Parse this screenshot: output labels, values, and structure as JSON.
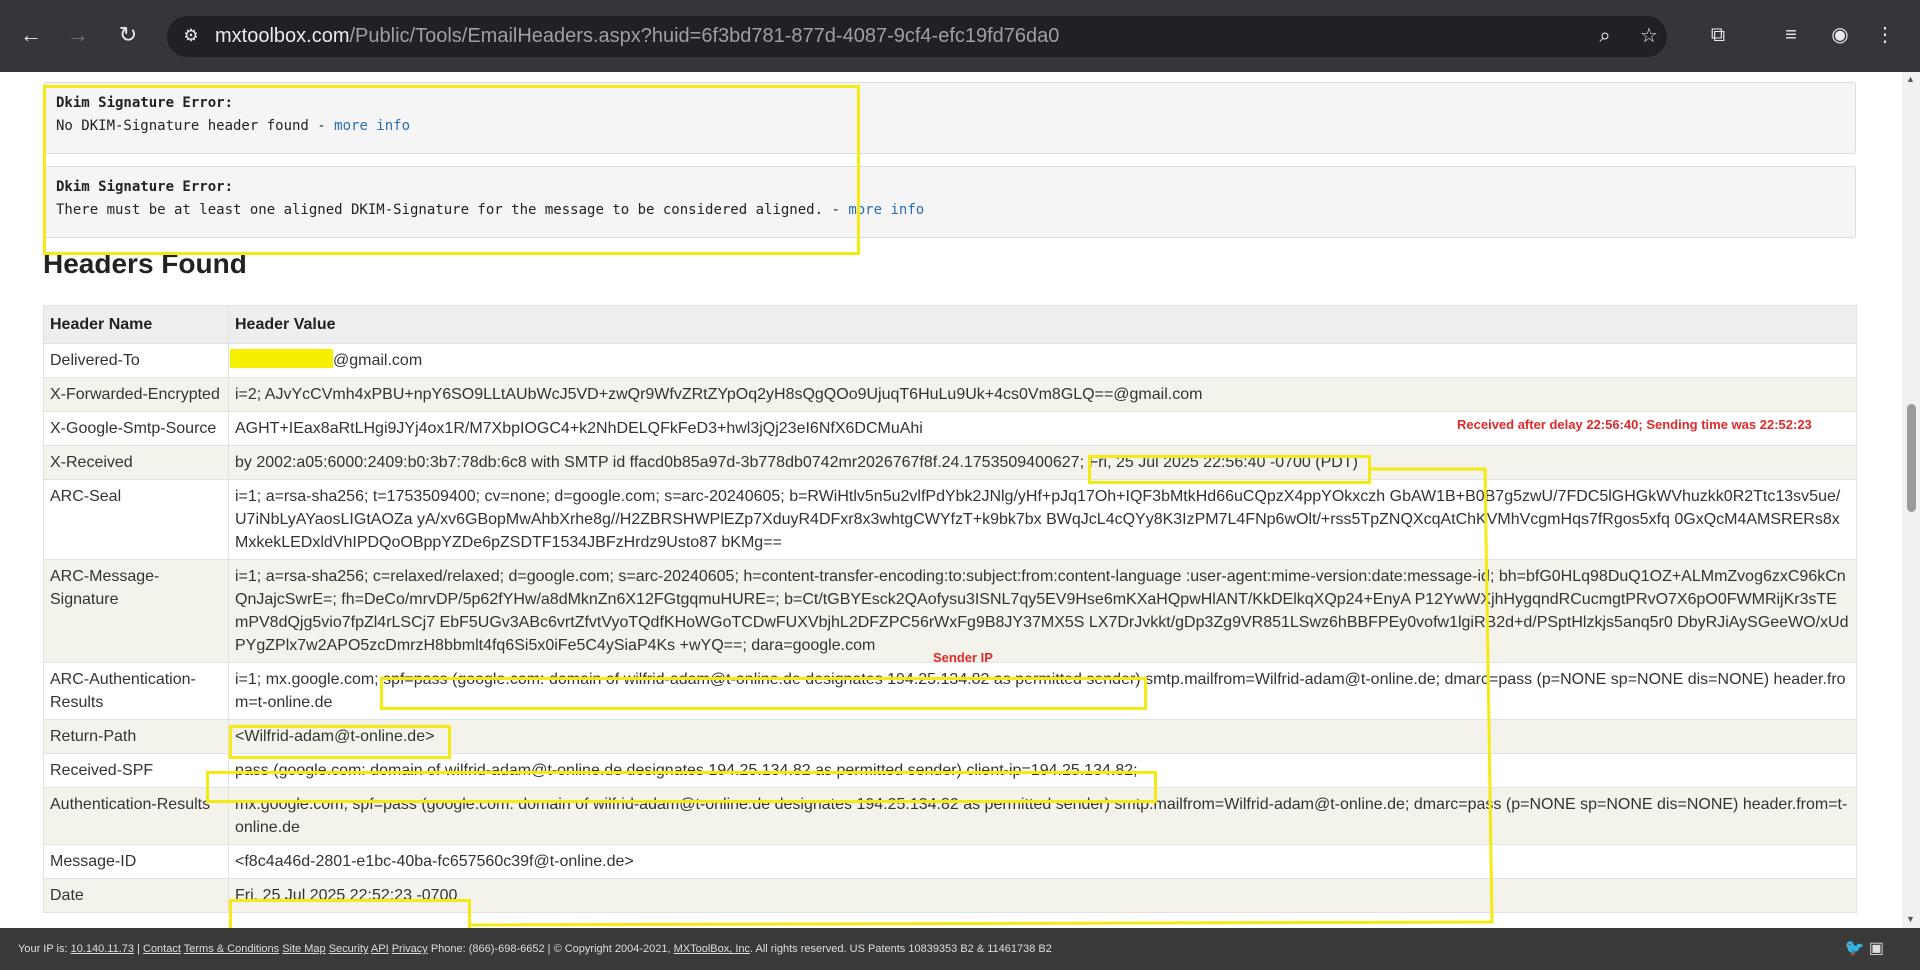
{
  "browser": {
    "url_host": "mxtoolbox.com",
    "url_path": "/Public/Tools/EmailHeaders.aspx?huid=6f3bd781-877d-4087-9cf4-efc19fd76da0",
    "icons": [
      "back-icon",
      "forward-icon",
      "reload-icon",
      "site-settings-icon",
      "zoom-icon",
      "star-icon",
      "extensions-icon",
      "media-icon",
      "profile-icon",
      "menu-icon"
    ]
  },
  "errors": [
    {
      "title": "Dkim Signature Error:",
      "message": "No DKIM-Signature header found - ",
      "link": "more info"
    },
    {
      "title": "Dkim Signature Error:",
      "message": "There must be at least one aligned DKIM-Signature for the message to be considered aligned. - ",
      "link": "more info"
    }
  ],
  "headers_title": "Headers Found",
  "table": {
    "col_name": "Header Name",
    "col_value": "Header Value",
    "rows": [
      {
        "name": "Delivered-To",
        "value": "@gmail.com"
      },
      {
        "name": "X-Forwarded-Encrypted",
        "value": "i=2; AJvYcCVmh4xPBU+npY6SO9LLtAUbWcJ5VD+zwQr9WfvZRtZYpOq2yH8sQgQOo9UjuqT6HuLu9Uk+4cs0Vm8GLQ==@gmail.com"
      },
      {
        "name": "X-Google-Smtp-Source",
        "value": "AGHT+IEax8aRtLHgi9JYj4ox1R/M7XbpIOGC4+k2NhDELQFkFeD3+hwl3jQj23eI6NfX6DCMuAhi"
      },
      {
        "name": "X-Received",
        "value": "by 2002:a05:6000:2409:b0:3b7:78db:6c8 with SMTP id ffacd0b85a97d-3b778db0742mr2026767f8f.24.1753509400627; Fri, 25 Jul 2025 22:56:40 -0700 (PDT)"
      },
      {
        "name": "ARC-Seal",
        "value": "i=1; a=rsa-sha256; t=1753509400; cv=none; d=google.com; s=arc-20240605; b=RWiHtlv5n5u2vlfPdYbk2JNlg/yHf+pJq17Oh+IQF3bMtkHd66uCQpzX4ppYOkxczh GbAW1B+B0B7g5zwU/7FDC5lGHGkWVhuzkk0R2Ttc13sv5ue/U7iNbLyAYaosLIGtAOZa yA/xv6GBopMwAhbXrhe8g//H2ZBRSHWPlEZp7XduyR4DFxr8x3whtgCWYfzT+k9bk7bx BWqJcL4cQYy8K3IzPM7L4FNp6wOlt/+rss5TpZNQXcqAtChKVMhVcgmHqs7fRgos5xfq 0GxQcM4AMSRERs8xMxkekLEDxldVhIPDQoOBppYZDe6pZSDTF1534JBFzHrdz9Usto87 bKMg=="
      },
      {
        "name": "ARC-Message-Signature",
        "value": "i=1; a=rsa-sha256; c=relaxed/relaxed; d=google.com; s=arc-20240605; h=content-transfer-encoding:to:subject:from:content-language :user-agent:mime-version:date:message-id; bh=bfG0HLq98DuQ1OZ+ALMmZvog6zxC96kCnQnJajcSwrE=; fh=DeCo/mrvDP/5p62fYHw/a8dMknZn6X12FGtgqmuHURE=; b=Ct/tGBYEsck2QAofysu3ISNL7qy5EV9Hse6mKXaHQpwHlANT/KkDElkqXQp24+EnyA P12YwWXjhHygqndRCucmgtPRvO7X6pO0FWMRijKr3sTEmPV8dQjg5vio7fpZl4rLSCj7 EbF5UGv3ABc6vrtZfvtVyoTQdfKHoWGoTCDwFUXVbjhL2DFZPC56rWxFg9B8JY37MX5S LX7DrJvkkt/gDp3Zg9VR851LSwz6hBBFPEy0vofw1lgiRB2d+d/PSptHlzkjs5anq5r0 DbyRJiAySGeeWO/xUdPYgZPlx7w2APO5zcDmrzH8bbmlt4fq6Si5x0iFe5C4ySiaP4Ks +wYQ==; dara=google.com"
      },
      {
        "name": "ARC-Authentication-Results",
        "value": "i=1; mx.google.com; spf=pass (google.com: domain of wilfrid-adam@t-online.de designates 194.25.134.82 as permitted sender) smtp.mailfrom=Wilfrid-adam@t-online.de; dmarc=pass (p=NONE sp=NONE dis=NONE) header.from=t-online.de"
      },
      {
        "name": "Return-Path",
        "value": "<Wilfrid-adam@t-online.de>"
      },
      {
        "name": "Received-SPF",
        "value": "pass (google.com: domain of wilfrid-adam@t-online.de designates 194.25.134.82 as permitted sender) client-ip=194.25.134.82;"
      },
      {
        "name": "Authentication-Results",
        "value": "mx.google.com; spf=pass (google.com: domain of wilfrid-adam@t-online.de designates 194.25.134.82 as permitted sender) smtp.mailfrom=Wilfrid-adam@t-online.de; dmarc=pass (p=NONE sp=NONE dis=NONE) header.from=t-online.de"
      },
      {
        "name": "Message-ID",
        "value": "<f8c4a46d-2801-e1bc-40ba-fc657560c39f@t-online.de>"
      },
      {
        "name": "Date",
        "value": "Fri, 25 Jul 2025 22:52:23 -0700"
      }
    ]
  },
  "annotations": {
    "delay_note": "Received after delay 22:56:40; Sending time was 22:52:23",
    "sender_ip_note": "Sender IP",
    "highlight_color": "#f5ea14",
    "annotation_color": "#e02a2a"
  },
  "footer": {
    "ip_label": "Your IP is: ",
    "ip_value": "10.140.11.73",
    "links": [
      "Contact",
      "Terms & Conditions",
      "Site Map",
      "Security",
      "API",
      "Privacy"
    ],
    "phone": "Phone: (866)-698-6652",
    "copyright": "© Copyright 2004-2021, ",
    "company_link": "MXToolBox, Inc",
    "rights": ". All rights reserved. US Patents 10839353 B2 & 11461738 B2"
  }
}
